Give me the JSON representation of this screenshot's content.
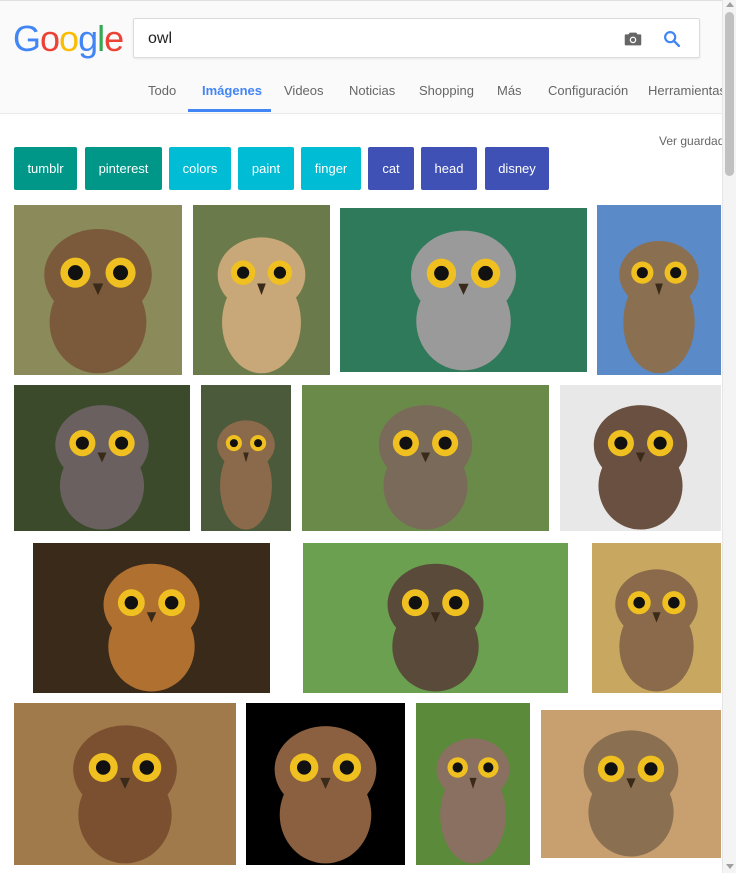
{
  "logo": {
    "letters": [
      "G",
      "o",
      "o",
      "g",
      "l",
      "e"
    ],
    "colors": [
      "#4285f4",
      "#ea4335",
      "#fbbc05",
      "#4285f4",
      "#34a853",
      "#ea4335"
    ]
  },
  "search": {
    "value": "owl",
    "camera_icon": "camera-icon",
    "search_icon": "search-icon",
    "accent": "#4285f4"
  },
  "tabs": [
    {
      "label": "Todo",
      "active": false
    },
    {
      "label": "Imágenes",
      "active": true
    },
    {
      "label": "Videos",
      "active": false
    },
    {
      "label": "Noticias",
      "active": false
    },
    {
      "label": "Shopping",
      "active": false
    },
    {
      "label": "Más",
      "active": false
    },
    {
      "label": "Configuración",
      "active": false
    },
    {
      "label": "Herramientas",
      "active": false
    }
  ],
  "saved_link": "Ver guardad",
  "chips": [
    {
      "label": "tumblr",
      "color": "#009688"
    },
    {
      "label": "pinterest",
      "color": "#009688"
    },
    {
      "label": "colors",
      "color": "#00bcd4"
    },
    {
      "label": "paint",
      "color": "#00bcd4"
    },
    {
      "label": "finger",
      "color": "#00bcd4"
    },
    {
      "label": "cat",
      "color": "#3f51b5"
    },
    {
      "label": "head",
      "color": "#3f51b5"
    },
    {
      "label": "disney",
      "color": "#3f51b5"
    }
  ],
  "results": [
    {
      "subject": "little-owl-on-rock",
      "bg": "#8a8a5a",
      "bird": "#7a5a3a"
    },
    {
      "subject": "barn-owl",
      "bg": "#6a7a4a",
      "bird": "#c8a878"
    },
    {
      "subject": "white-faced-owl",
      "bg": "#2f7a5a",
      "bird": "#9a9a9a"
    },
    {
      "subject": "little-owl-on-post",
      "bg": "#5a8ac8",
      "bird": "#8a7050"
    },
    {
      "subject": "screech-owl-closeup",
      "bg": "#3a4a2a",
      "bird": "#6a6060"
    },
    {
      "subject": "eagle-owl-standing",
      "bg": "#4a5a3a",
      "bird": "#8a6a4a"
    },
    {
      "subject": "owl-wings-spread",
      "bg": "#6a8a4a",
      "bird": "#7a6a5a"
    },
    {
      "subject": "eagle-owl-profile",
      "bg": "#e8e8e8",
      "bird": "#6a5040"
    },
    {
      "subject": "owl-eyes-closeup",
      "bg": "#3a2a1a",
      "bird": "#b07030"
    },
    {
      "subject": "owl-flying",
      "bg": "#6aa050",
      "bird": "#5a4a3a"
    },
    {
      "subject": "small-owl-on-branch",
      "bg": "#c8a860",
      "bird": "#8a6a4a"
    },
    {
      "subject": "great-horned-owl",
      "bg": "#a07a4a",
      "bird": "#7a5030"
    },
    {
      "subject": "horned-owl-black-bg",
      "bg": "#000000",
      "bird": "#8a6040"
    },
    {
      "subject": "barred-owl-on-branch",
      "bg": "#5a8a3a",
      "bird": "#8a7060"
    },
    {
      "subject": "little-owl-on-rocks",
      "bg": "#c8a070",
      "bird": "#8a7050"
    }
  ]
}
